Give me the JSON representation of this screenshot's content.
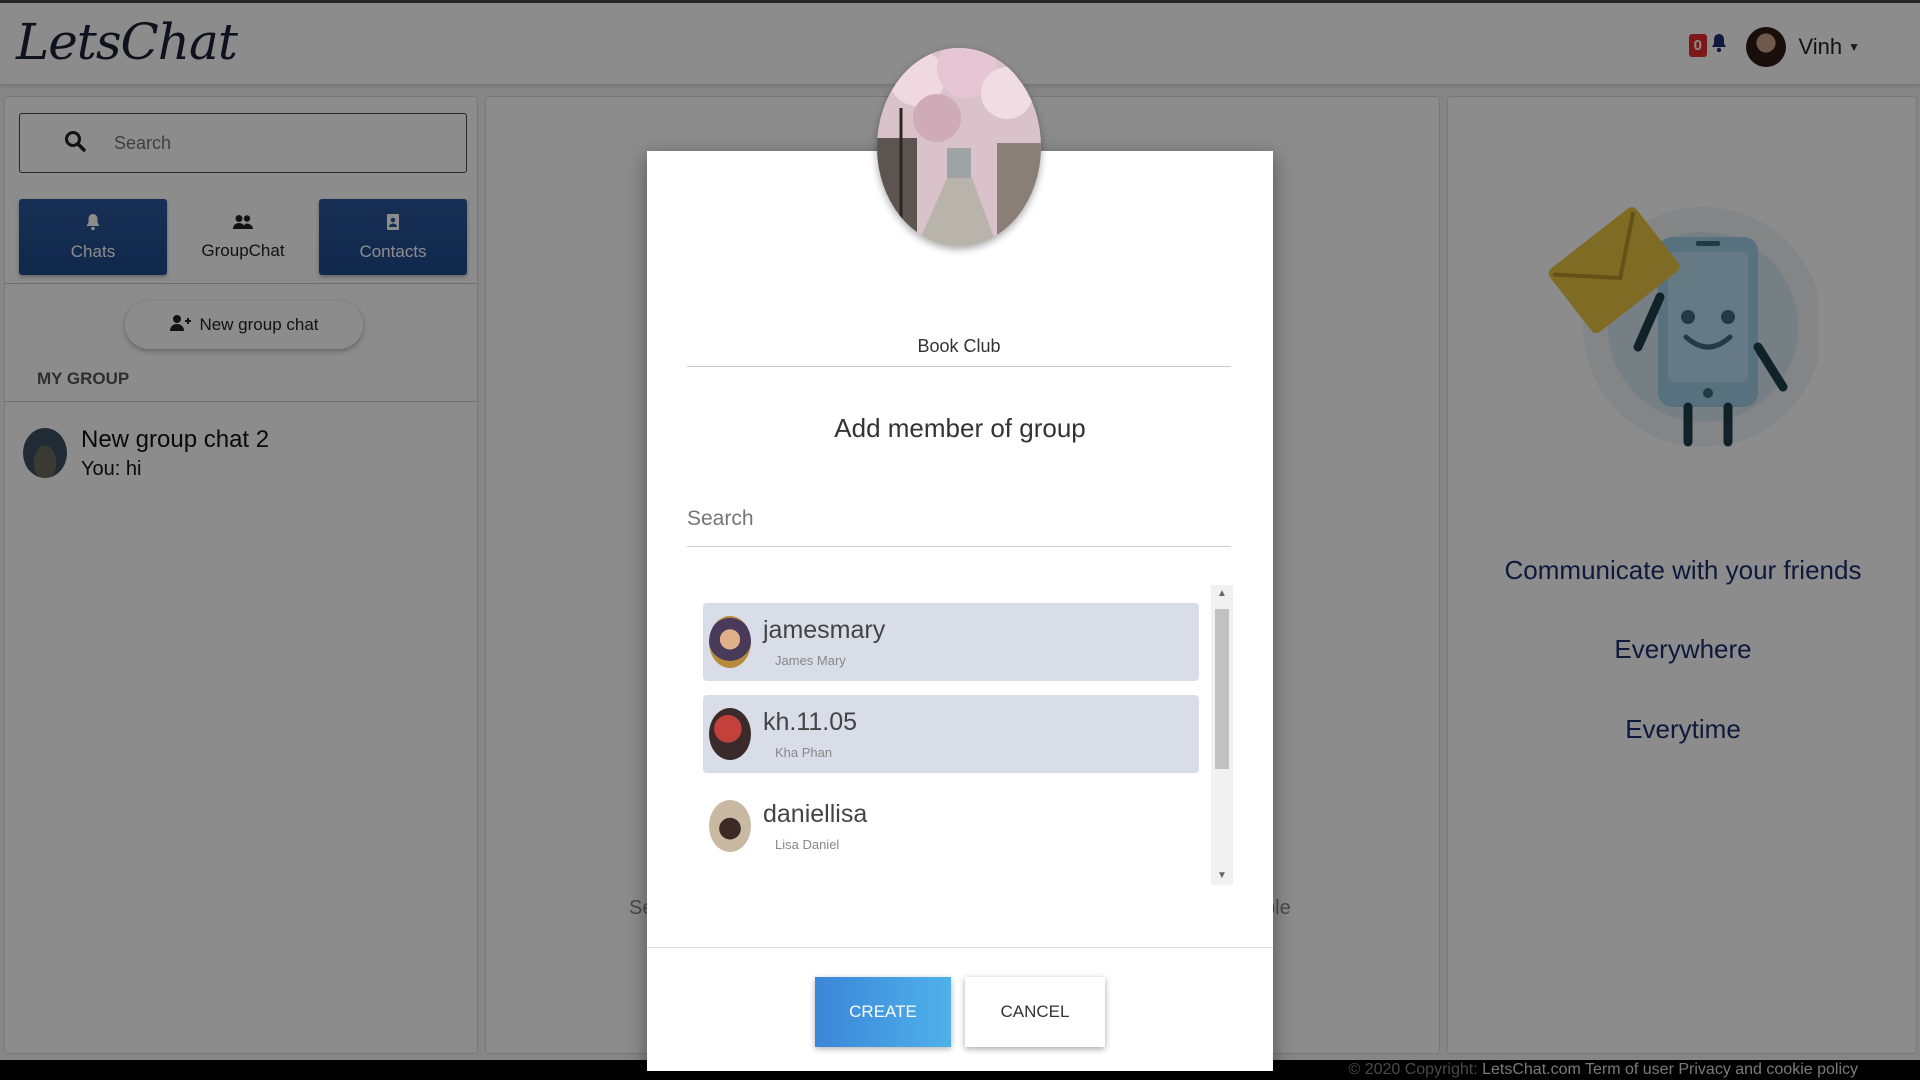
{
  "header": {
    "logo": "LetsChat",
    "notification_count": "0",
    "user_name": "Vinh"
  },
  "sidebar": {
    "search_placeholder": "Search",
    "tabs": [
      {
        "label": "Chats",
        "icon": "bell-icon"
      },
      {
        "label": "GroupChat",
        "icon": "users-icon"
      },
      {
        "label": "Contacts",
        "icon": "contact-book-icon"
      }
    ],
    "new_group_label": "New group chat",
    "section_label": "MY GROUP",
    "groups": [
      {
        "name": "New group chat 2",
        "last_message": "You: hi"
      }
    ]
  },
  "main": {
    "hint_left": "Se",
    "hint_right": "ble"
  },
  "welcome": {
    "lines": [
      "Communicate with your friends",
      "Everywhere",
      "Everytime"
    ]
  },
  "modal": {
    "group_name_value": "Book Club",
    "title": "Add member of group",
    "search_placeholder": "Search",
    "members": [
      {
        "username": "jamesmary",
        "full_name": "James Mary",
        "selected": true
      },
      {
        "username": "kh.11.05",
        "full_name": "Kha Phan",
        "selected": true
      },
      {
        "username": "daniellisa",
        "full_name": "Lisa Daniel",
        "selected": false
      }
    ],
    "create_label": "CREATE",
    "cancel_label": "CANCEL"
  },
  "footer": {
    "copyright": "© 2020 Copyright:",
    "site": "LetsChat.com",
    "terms": "Term of user",
    "privacy": "Privacy and cookie policy"
  },
  "colors": {
    "accent_blue": "#2b5799",
    "create_button": "#3b86d8",
    "badge_red": "#e52b2b",
    "welcome_text": "#1c2e6e"
  }
}
